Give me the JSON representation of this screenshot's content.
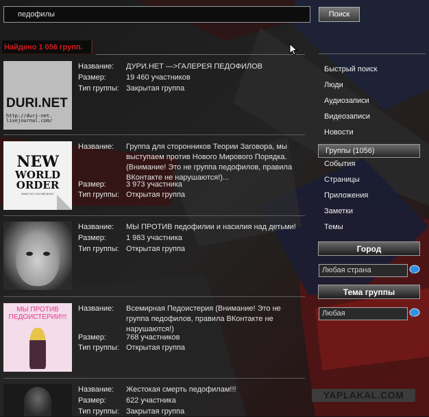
{
  "search": {
    "value": "педофилы",
    "button": "Поиск"
  },
  "found_text": "Найдено 1 056 групп.",
  "labels": {
    "name": "Название:",
    "size": "Размер:",
    "type": "Тип группы:"
  },
  "results": [
    {
      "name": "ДУРИ.НЕТ —>ГАЛЕРЕЯ ПЕДОФИЛОВ",
      "size": "19 460 участников",
      "type": "Закрытая группа",
      "thumb": {
        "title": "DURI.NET",
        "caption1": "http://duri-net.",
        "caption2": "livejournal.com/"
      }
    },
    {
      "name": "Группа для сторонников Теории Заговора, мы выступаем против Нового Мирового Порядка. (Внимание! Это не группа педофилов, правила ВКонтакте не нарушаются!)...",
      "size": "3 973 участника",
      "type": "Открытая группа",
      "thumb": {
        "line1": "NEW",
        "line2": "WORLD",
        "line3": "ORDER",
        "tag": "WHAT DO YOU BELIEVE?"
      }
    },
    {
      "name": "МЫ ПРОТИВ педофилии и насилия над детьми!",
      "size": "1 983 участника",
      "type": "Открытая группа"
    },
    {
      "name": "Всемирная Педоистерия (Внимание! Это не группа педофилов, правила ВКонтакте не нарушаются!)",
      "size": "768 участников",
      "type": "Открытая группа",
      "thumb": {
        "line1": "МЫ ПРОТИВ",
        "line2": "ПЕДОИСТЕРИИ!!!"
      }
    },
    {
      "name": "Жестокая смерть педофилам!!!",
      "size": "622 участника",
      "type": "Закрытая группа"
    }
  ],
  "menu": [
    "Быстрый поиск",
    "Люди",
    "Аудиозаписи",
    "Видеозаписи",
    "Новости",
    "Группы (1056)",
    "События",
    "Страницы",
    "Приложения",
    "Заметки",
    "Темы"
  ],
  "city": {
    "header": "Город",
    "value": "Любая страна"
  },
  "theme": {
    "header": "Тема группы",
    "value": "Любая"
  },
  "watermark": "YAPLAKAL.COM",
  "colors": {
    "found_red": "#d51a1a",
    "flag_red": "#8c1c1c",
    "flag_blue": "#1a2140"
  }
}
